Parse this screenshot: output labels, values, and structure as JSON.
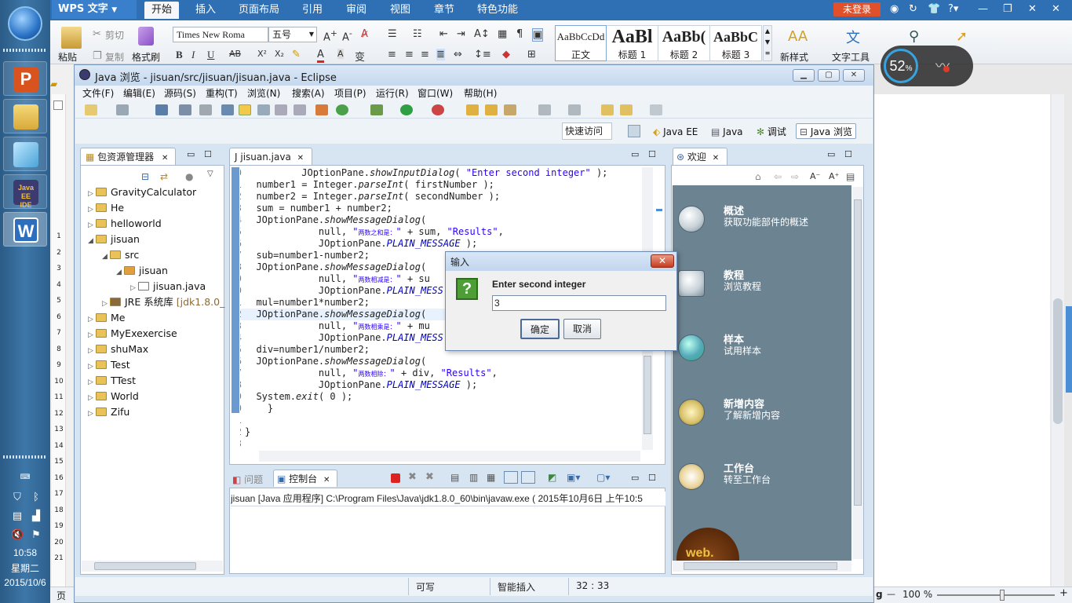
{
  "taskbar": {
    "time": "10:58",
    "weekday": "星期二",
    "date": "2015/10/6",
    "apps": [
      {
        "name": "wps-presentation",
        "glyph": "P",
        "color": "#d9531e"
      },
      {
        "name": "file-explorer",
        "glyph": "",
        "color": "#e8c45a"
      },
      {
        "name": "notepad",
        "glyph": "",
        "color": "#7fc7e8"
      },
      {
        "name": "eclipse-javaee",
        "glyph": "",
        "color": "#3a3a6a"
      },
      {
        "name": "wps-writer",
        "glyph": "W",
        "color": "#2d6fbe"
      }
    ]
  },
  "wps": {
    "brand": "WPS 文字",
    "tabs": [
      "开始",
      "插入",
      "页面布局",
      "引用",
      "审阅",
      "视图",
      "章节",
      "特色功能"
    ],
    "login": "未登录",
    "ribbon": {
      "paste": "粘贴",
      "cut": "剪切",
      "copy": "复制",
      "format_painter": "格式刷",
      "font_name": "Times New Roma",
      "font_size": "五号",
      "styles": [
        {
          "sample": "AaBbCcDd",
          "name": "正文"
        },
        {
          "sample": "AaBl",
          "name": "标题 1"
        },
        {
          "sample": "AaBb(",
          "name": "标题 2"
        },
        {
          "sample": "AaBbC",
          "name": "标题 3"
        }
      ],
      "new_style": "新样式",
      "text_tools": "文字工具"
    },
    "battery_percent": "52",
    "battery_unit": "%",
    "ruler": [
      "1",
      "2",
      "3",
      "4",
      "5",
      "6",
      "7",
      "8",
      "9",
      "10",
      "11",
      "12",
      "13",
      "14",
      "15",
      "16",
      "17",
      "18",
      "19",
      "20",
      "21"
    ],
    "status_left": "页",
    "zoom": "100 %"
  },
  "eclipse": {
    "title": "Java 浏览  - jisuan/src/jisuan/jisuan.java  - Eclipse",
    "menu": [
      "文件(F)",
      "编辑(E)",
      "源码(S)",
      "重构(T)",
      "浏览(N)",
      "搜索(A)",
      "项目(P)",
      "运行(R)",
      "窗口(W)",
      "帮助(H)"
    ],
    "quick_access": "快速访问",
    "perspectives": [
      "Java EE",
      "Java",
      "调试",
      "Java 浏览"
    ],
    "package_explorer": {
      "tab": "包资源管理器",
      "items": [
        {
          "label": "GravityCalculator",
          "level": 0,
          "arrow": "▷"
        },
        {
          "label": "He",
          "level": 0,
          "arrow": "▷"
        },
        {
          "label": "helloworld",
          "level": 0,
          "arrow": "▷"
        },
        {
          "label": "jisuan",
          "level": 0,
          "arrow": "◢"
        },
        {
          "label": "src",
          "level": 1,
          "arrow": "◢"
        },
        {
          "label": "jisuan",
          "level": 2,
          "arrow": "◢"
        },
        {
          "label": "jisuan.java",
          "level": 3,
          "arrow": "▷"
        },
        {
          "label": "JRE 系统库",
          "extra": "[jdk1.8.0_",
          "level": 1,
          "arrow": "▷"
        },
        {
          "label": "Me",
          "level": 0,
          "arrow": "▷"
        },
        {
          "label": "MyExexercise",
          "level": 0,
          "arrow": "▷"
        },
        {
          "label": "shuMax",
          "level": 0,
          "arrow": "▷"
        },
        {
          "label": "Test",
          "level": 0,
          "arrow": "▷"
        },
        {
          "label": "TTest",
          "level": 0,
          "arrow": "▷"
        },
        {
          "label": "World",
          "level": 0,
          "arrow": "▷"
        },
        {
          "label": "Zifu",
          "level": 0,
          "arrow": "▷"
        }
      ]
    },
    "editor": {
      "tab": "jisuan.java",
      "lines": [
        {
          "n": "20",
          "html": "          JOptionPane.<i>showInputDialog</i>( <span class='s'>\"Enter second integer\"</span> );"
        },
        {
          "n": "21",
          "html": "  number1 = Integer.<i>parseInt</i>( firstNumber );"
        },
        {
          "n": "22",
          "html": "  number2 = Integer.<i>parseInt</i>( secondNumber );"
        },
        {
          "n": "23",
          "html": "  sum = number1 + number2;"
        },
        {
          "n": "24",
          "html": "  JOptionPane.<i>showMessageDialog</i>("
        },
        {
          "n": "25",
          "html": "             null, <span class='s'>\"<span class='cj'>两数之和是：</span>\"</span> + sum, <span class='s'>\"Results\"</span>,"
        },
        {
          "n": "26",
          "html": "             JOptionPane.<span class='st'>PLAIN_MESSAGE</span> );"
        },
        {
          "n": "27",
          "html": "  sub=number1-number2;"
        },
        {
          "n": "28",
          "html": "  JOptionPane.<i>showMessageDialog</i>("
        },
        {
          "n": "29",
          "html": "             null, <span class='s'>\"<span class='cj'>两数相减是：</span>\"</span> + su"
        },
        {
          "n": "30",
          "html": "             JOptionPane.<span class='st'>PLAIN_MESS</span>"
        },
        {
          "n": "31",
          "html": "  mul=number1*number2;"
        },
        {
          "n": "32",
          "html": "  JOptionPane.<i>showMessageDialog</i>(",
          "cur": true
        },
        {
          "n": "33",
          "html": "             null, <span class='s'>\"<span class='cj'>两数相乘是：</span>\"</span> + mu"
        },
        {
          "n": "34",
          "html": "             JOptionPane.<span class='st'>PLAIN_MESS</span>"
        },
        {
          "n": "35",
          "html": "  div=number1/number2;"
        },
        {
          "n": "36",
          "html": "  JOptionPane.<i>showMessageDialog</i>("
        },
        {
          "n": "37",
          "html": "             null, <span class='s'>\"<span class='cj'>两数相除：</span>\"</span> + div, <span class='s'>\"Results\"</span>,"
        },
        {
          "n": "38",
          "html": "             JOptionPane.<span class='st'>PLAIN_MESSAGE</span> );"
        },
        {
          "n": "39",
          "html": "  System.<i>exit</i>( 0 );"
        },
        {
          "n": "40",
          "html": "    }"
        },
        {
          "n": "41",
          "html": ""
        },
        {
          "n": "42",
          "html": "}"
        },
        {
          "n": "43",
          "html": ""
        }
      ]
    },
    "welcome": {
      "tab": "欢迎",
      "items": [
        {
          "title": "概述",
          "desc": "获取功能部件的概述",
          "icon": "globe-icon"
        },
        {
          "title": "教程",
          "desc": "浏览教程",
          "icon": "tutorial-icon"
        },
        {
          "title": "样本",
          "desc": "试用样本",
          "icon": "samples-icon"
        },
        {
          "title": "新增内容",
          "desc": "了解新增内容",
          "icon": "star-icon"
        },
        {
          "title": "工作台",
          "desc": "转至工作台",
          "icon": "workbench-icon"
        }
      ],
      "web": "web."
    },
    "console": {
      "tab_problems": "问题",
      "tab_console": "控制台",
      "text": "jisuan [Java 应用程序] C:\\Program Files\\Java\\jdk1.8.0_60\\bin\\javaw.exe ( 2015年10月6日 上午10:5"
    },
    "status": {
      "writable": "可写",
      "insert_mode": "智能插入",
      "position": "32 : 33"
    }
  },
  "dialog": {
    "title": "输入",
    "message": "Enter second integer",
    "value": "3",
    "ok": "确定",
    "cancel": "取消"
  }
}
